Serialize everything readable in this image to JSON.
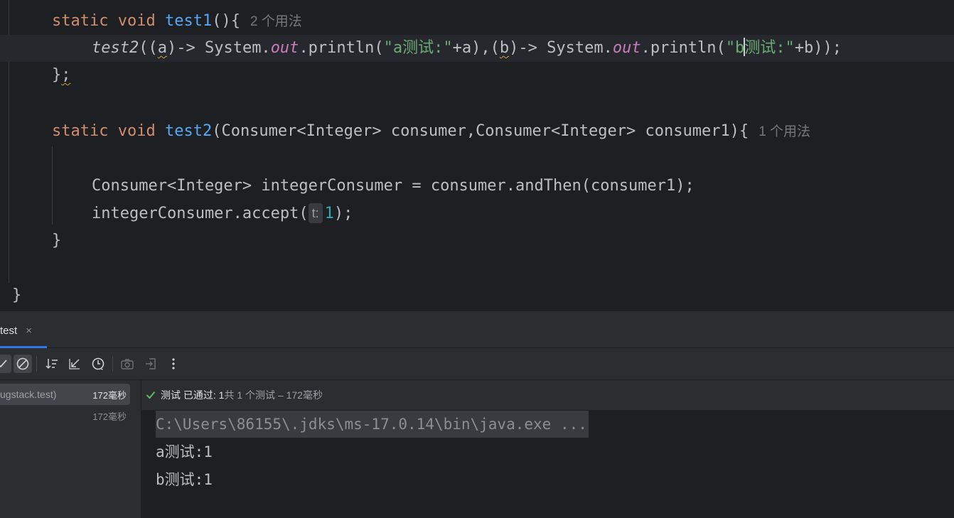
{
  "editor": {
    "line_test1": {
      "kw_static": "static",
      "kw_void": "void",
      "fn_name": "test1",
      "punct": "(){",
      "usage_hint": "2 个用法"
    },
    "line_call": {
      "call_name": "test2",
      "p1": "((",
      "a_param": "a",
      "p2": ")-> System.",
      "out1": "out",
      "p3": ".println(",
      "str1": "\"a测试:\"",
      "p4": "+a)",
      "comma": ",",
      "p5": "(",
      "b_param": "b",
      "p6": ")-> System.",
      "out2": "out",
      "p7": ".println(",
      "str2a": "\"b",
      "str2b": "测试:\"",
      "p8": "+b));"
    },
    "line_close1": {
      "brace": "}",
      "semi": ";"
    },
    "line_test2": {
      "kw_static": "static",
      "kw_void": "void",
      "fn_name": "test2",
      "params": "(Consumer<Integer> consumer,Consumer<Integer> consumer1){",
      "usage_hint": "1 个用法"
    },
    "line_consumer": "Consumer<Integer> integerConsumer = consumer.andThen(consumer1);",
    "line_accept": {
      "pre": "integerConsumer.accept(",
      "inlay": "t:",
      "num": "1",
      "post": ");"
    },
    "line_close2": "}",
    "line_close3": "}"
  },
  "panel": {
    "tab_label": "test",
    "tab_close": "×",
    "tree": [
      {
        "name": "ugstack.test)",
        "time": "172毫秒"
      },
      {
        "name": "",
        "time": "172毫秒"
      }
    ],
    "status": {
      "passed": "测试 已通过: 1",
      "rest": "共 1 个测试 – 172毫秒"
    },
    "output": [
      "C:\\Users\\86155\\.jdks\\ms-17.0.14\\bin\\java.exe ...",
      "a测试:1",
      "b测试:1"
    ]
  },
  "colors": {
    "editor_bg": "#1e1f22",
    "panel_bg": "#2b2d30",
    "keyword": "#cf8e6d",
    "function": "#56a8f5",
    "string": "#6aab73",
    "number": "#2aacb8",
    "field": "#c77dbb",
    "accent": "#3574f0",
    "pass_green": "#5fb865"
  }
}
